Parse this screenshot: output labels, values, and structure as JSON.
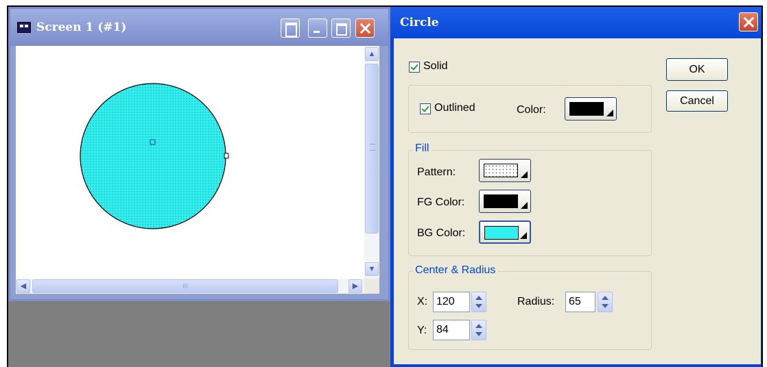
{
  "screen_window": {
    "title": "Screen 1 (#1)",
    "hscroll_grip": "III",
    "circle": {
      "fill": "#33f0f0",
      "outline": "#000000",
      "pattern": "dots"
    }
  },
  "dialog": {
    "title": "Circle",
    "solid_label": "Solid",
    "solid_checked": true,
    "ok_label": "OK",
    "cancel_label": "Cancel",
    "outlined_label": "Outlined",
    "outlined_checked": true,
    "outline_color_label": "Color:",
    "outline_color": "#000000",
    "fill": {
      "legend": "Fill",
      "pattern_label": "Pattern:",
      "fg_label": "FG Color:",
      "fg_color": "#000000",
      "bg_label": "BG Color:",
      "bg_color": "#33f0f0"
    },
    "geometry": {
      "legend": "Center & Radius",
      "x_label": "X:",
      "x_value": "120",
      "y_label": "Y:",
      "y_value": "84",
      "radius_label": "Radius:",
      "radius_value": "65"
    }
  }
}
